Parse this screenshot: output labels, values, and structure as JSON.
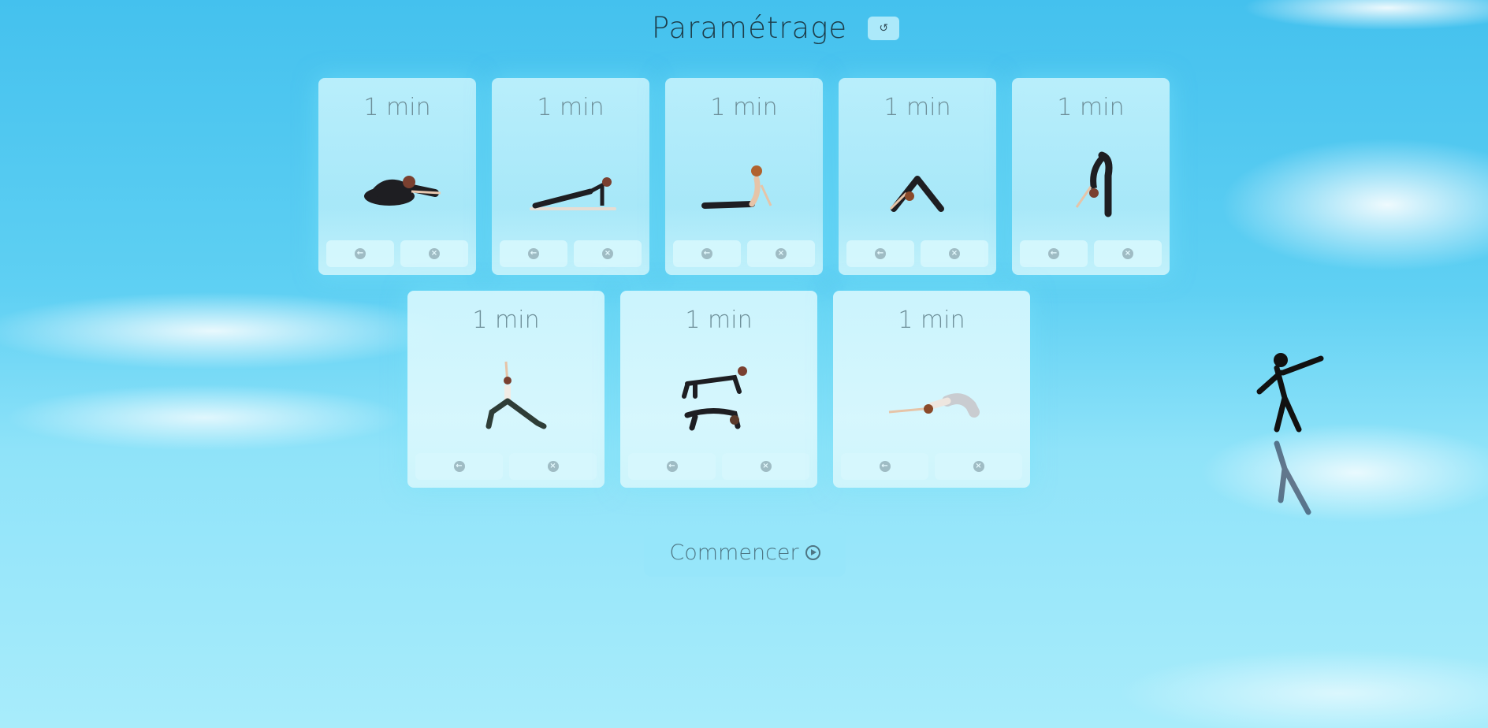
{
  "header": {
    "title": "Paramétrage",
    "reset_icon": "reset-icon"
  },
  "exercises": [
    {
      "duration": "1 min",
      "pose": "seated-forward-fold"
    },
    {
      "duration": "1 min",
      "pose": "plank"
    },
    {
      "duration": "1 min",
      "pose": "cobra"
    },
    {
      "duration": "1 min",
      "pose": "downward-dog"
    },
    {
      "duration": "1 min",
      "pose": "standing-forward-fold"
    },
    {
      "duration": "1 min",
      "pose": "crescent-lunge"
    },
    {
      "duration": "1 min",
      "pose": "cat-cow"
    },
    {
      "duration": "1 min",
      "pose": "child-pose"
    }
  ],
  "buttons": {
    "back_icon": "arrow-left-icon",
    "remove_icon": "close-icon"
  },
  "start": {
    "label": "Commencer",
    "icon": "play-icon"
  }
}
